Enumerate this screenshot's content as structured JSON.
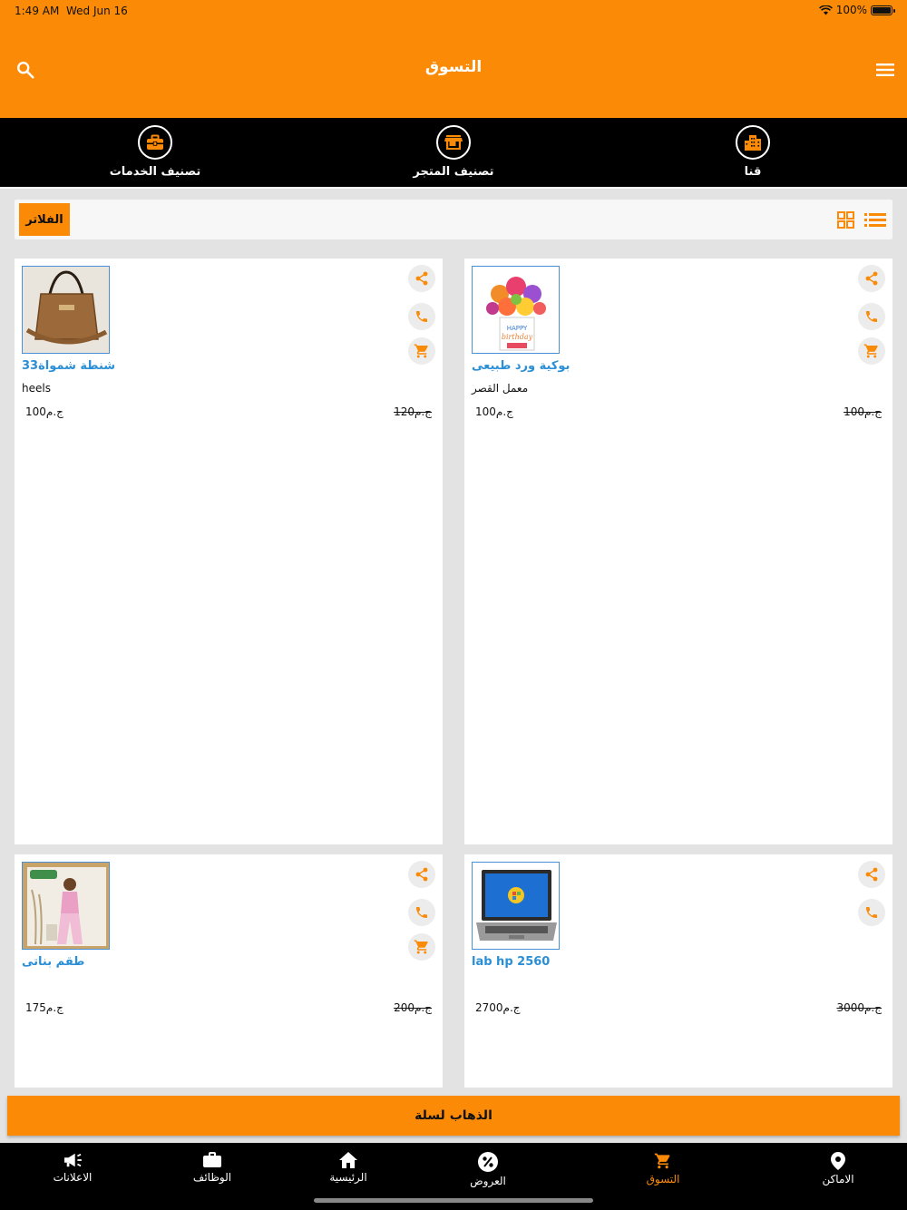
{
  "status": {
    "time": "1:49 AM",
    "date": "Wed Jun 16",
    "battery": "100%"
  },
  "header": {
    "title": "التسوق"
  },
  "categories": [
    {
      "label": "تصنيف الخدمات",
      "icon": "toolbox-icon"
    },
    {
      "label": "تصنيف المتجر",
      "icon": "store-icon"
    },
    {
      "label": "قنا",
      "icon": "city-icon"
    }
  ],
  "filter": {
    "label": "الفلاتر"
  },
  "products": [
    {
      "name": "شنطة شمواة33",
      "store": "heels",
      "price": "100ج.م",
      "old_price": "120ج.م",
      "has_cart": true,
      "image": "bag"
    },
    {
      "name": "بوكية ورد طبيعى",
      "store": "معمل القصر",
      "price": "100ج.م",
      "old_price": "100ج.م",
      "has_cart": true,
      "image": "flowers"
    },
    {
      "name": "طقم بناتى",
      "store": "",
      "price": "175ج.م",
      "old_price": "200ج.م",
      "has_cart": true,
      "image": "outfit"
    },
    {
      "name": "lab hp 2560",
      "store": "",
      "price": "2700ج.م",
      "old_price": "3000ج.م",
      "has_cart": false,
      "image": "laptop"
    }
  ],
  "cart_button": {
    "label": "الذهاب لسلة"
  },
  "nav": [
    {
      "label": "الاعلانات",
      "icon": "megaphone-icon",
      "active": false
    },
    {
      "label": "الوظائف",
      "icon": "briefcase-icon",
      "active": false
    },
    {
      "label": "الرئيسية",
      "icon": "home-icon",
      "active": false
    },
    {
      "label": "العروض",
      "icon": "percent-icon",
      "active": false
    },
    {
      "label": "التسوق",
      "icon": "cart-icon",
      "active": true
    },
    {
      "label": "الاماكن",
      "icon": "location-pin-icon",
      "active": false
    }
  ],
  "colors": {
    "accent": "#fb8a06",
    "link": "#2b8fd6",
    "dark": "#000000"
  }
}
